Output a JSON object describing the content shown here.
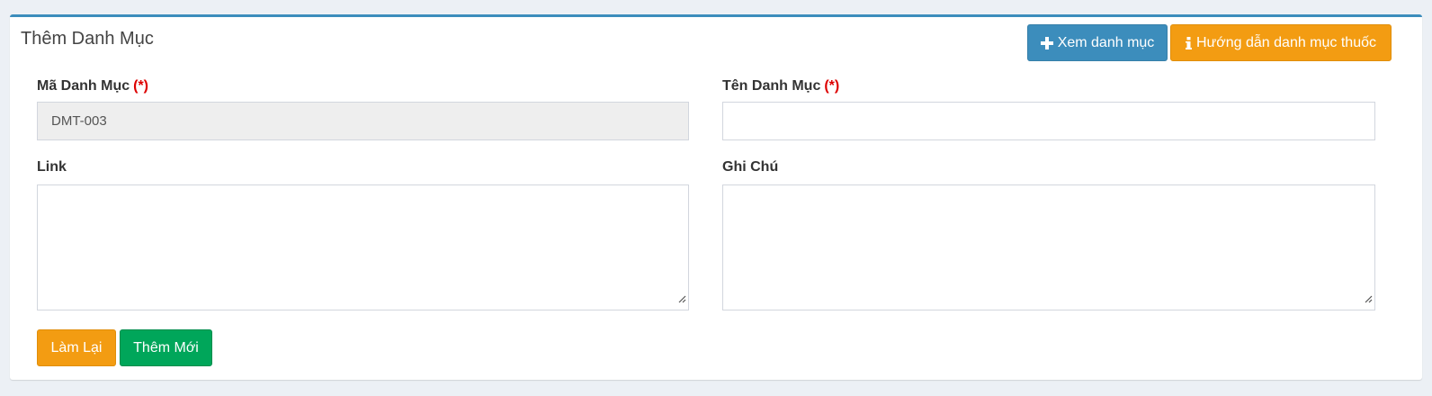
{
  "header": {
    "title": "Thêm Danh Mục",
    "view_button": "Xem danh mục",
    "guide_button": "Hướng dẫn danh mục thuốc"
  },
  "form": {
    "required_mark": "(*)",
    "code": {
      "label": "Mã Danh Mục",
      "value": "DMT-003"
    },
    "name": {
      "label": "Tên Danh Mục",
      "value": ""
    },
    "link": {
      "label": "Link",
      "value": ""
    },
    "note": {
      "label": "Ghi Chú",
      "value": ""
    }
  },
  "actions": {
    "reset": "Làm Lại",
    "submit": "Thêm Mới"
  },
  "colors": {
    "primary": "#3c8dbc",
    "warning": "#f39c12",
    "success": "#00a65a",
    "required": "#dd0000"
  },
  "icons": {
    "view": "plus-icon",
    "guide": "info-icon",
    "resize": "resize-grip-icon"
  }
}
